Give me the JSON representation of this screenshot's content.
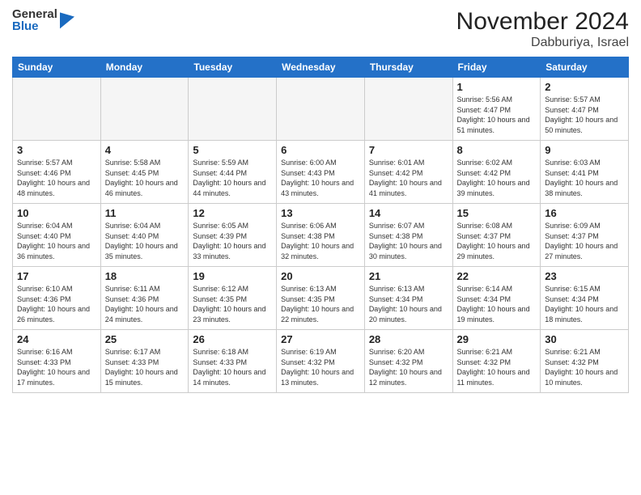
{
  "header": {
    "logo_general": "General",
    "logo_blue": "Blue",
    "month_title": "November 2024",
    "location": "Dabburiya, Israel"
  },
  "weekdays": [
    "Sunday",
    "Monday",
    "Tuesday",
    "Wednesday",
    "Thursday",
    "Friday",
    "Saturday"
  ],
  "weeks": [
    [
      {
        "day": "",
        "info": ""
      },
      {
        "day": "",
        "info": ""
      },
      {
        "day": "",
        "info": ""
      },
      {
        "day": "",
        "info": ""
      },
      {
        "day": "",
        "info": ""
      },
      {
        "day": "1",
        "info": "Sunrise: 5:56 AM\nSunset: 4:47 PM\nDaylight: 10 hours\nand 51 minutes."
      },
      {
        "day": "2",
        "info": "Sunrise: 5:57 AM\nSunset: 4:47 PM\nDaylight: 10 hours\nand 50 minutes."
      }
    ],
    [
      {
        "day": "3",
        "info": "Sunrise: 5:57 AM\nSunset: 4:46 PM\nDaylight: 10 hours\nand 48 minutes."
      },
      {
        "day": "4",
        "info": "Sunrise: 5:58 AM\nSunset: 4:45 PM\nDaylight: 10 hours\nand 46 minutes."
      },
      {
        "day": "5",
        "info": "Sunrise: 5:59 AM\nSunset: 4:44 PM\nDaylight: 10 hours\nand 44 minutes."
      },
      {
        "day": "6",
        "info": "Sunrise: 6:00 AM\nSunset: 4:43 PM\nDaylight: 10 hours\nand 43 minutes."
      },
      {
        "day": "7",
        "info": "Sunrise: 6:01 AM\nSunset: 4:42 PM\nDaylight: 10 hours\nand 41 minutes."
      },
      {
        "day": "8",
        "info": "Sunrise: 6:02 AM\nSunset: 4:42 PM\nDaylight: 10 hours\nand 39 minutes."
      },
      {
        "day": "9",
        "info": "Sunrise: 6:03 AM\nSunset: 4:41 PM\nDaylight: 10 hours\nand 38 minutes."
      }
    ],
    [
      {
        "day": "10",
        "info": "Sunrise: 6:04 AM\nSunset: 4:40 PM\nDaylight: 10 hours\nand 36 minutes."
      },
      {
        "day": "11",
        "info": "Sunrise: 6:04 AM\nSunset: 4:40 PM\nDaylight: 10 hours\nand 35 minutes."
      },
      {
        "day": "12",
        "info": "Sunrise: 6:05 AM\nSunset: 4:39 PM\nDaylight: 10 hours\nand 33 minutes."
      },
      {
        "day": "13",
        "info": "Sunrise: 6:06 AM\nSunset: 4:38 PM\nDaylight: 10 hours\nand 32 minutes."
      },
      {
        "day": "14",
        "info": "Sunrise: 6:07 AM\nSunset: 4:38 PM\nDaylight: 10 hours\nand 30 minutes."
      },
      {
        "day": "15",
        "info": "Sunrise: 6:08 AM\nSunset: 4:37 PM\nDaylight: 10 hours\nand 29 minutes."
      },
      {
        "day": "16",
        "info": "Sunrise: 6:09 AM\nSunset: 4:37 PM\nDaylight: 10 hours\nand 27 minutes."
      }
    ],
    [
      {
        "day": "17",
        "info": "Sunrise: 6:10 AM\nSunset: 4:36 PM\nDaylight: 10 hours\nand 26 minutes."
      },
      {
        "day": "18",
        "info": "Sunrise: 6:11 AM\nSunset: 4:36 PM\nDaylight: 10 hours\nand 24 minutes."
      },
      {
        "day": "19",
        "info": "Sunrise: 6:12 AM\nSunset: 4:35 PM\nDaylight: 10 hours\nand 23 minutes."
      },
      {
        "day": "20",
        "info": "Sunrise: 6:13 AM\nSunset: 4:35 PM\nDaylight: 10 hours\nand 22 minutes."
      },
      {
        "day": "21",
        "info": "Sunrise: 6:13 AM\nSunset: 4:34 PM\nDaylight: 10 hours\nand 20 minutes."
      },
      {
        "day": "22",
        "info": "Sunrise: 6:14 AM\nSunset: 4:34 PM\nDaylight: 10 hours\nand 19 minutes."
      },
      {
        "day": "23",
        "info": "Sunrise: 6:15 AM\nSunset: 4:34 PM\nDaylight: 10 hours\nand 18 minutes."
      }
    ],
    [
      {
        "day": "24",
        "info": "Sunrise: 6:16 AM\nSunset: 4:33 PM\nDaylight: 10 hours\nand 17 minutes."
      },
      {
        "day": "25",
        "info": "Sunrise: 6:17 AM\nSunset: 4:33 PM\nDaylight: 10 hours\nand 15 minutes."
      },
      {
        "day": "26",
        "info": "Sunrise: 6:18 AM\nSunset: 4:33 PM\nDaylight: 10 hours\nand 14 minutes."
      },
      {
        "day": "27",
        "info": "Sunrise: 6:19 AM\nSunset: 4:32 PM\nDaylight: 10 hours\nand 13 minutes."
      },
      {
        "day": "28",
        "info": "Sunrise: 6:20 AM\nSunset: 4:32 PM\nDaylight: 10 hours\nand 12 minutes."
      },
      {
        "day": "29",
        "info": "Sunrise: 6:21 AM\nSunset: 4:32 PM\nDaylight: 10 hours\nand 11 minutes."
      },
      {
        "day": "30",
        "info": "Sunrise: 6:21 AM\nSunset: 4:32 PM\nDaylight: 10 hours\nand 10 minutes."
      }
    ]
  ]
}
